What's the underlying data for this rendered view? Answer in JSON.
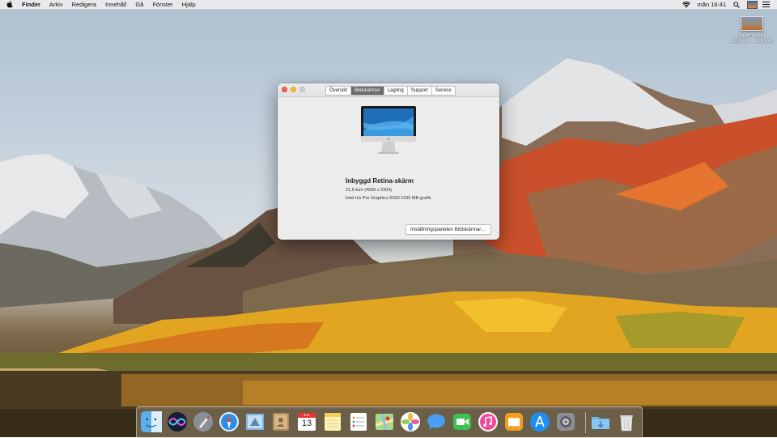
{
  "menubar": {
    "apple_icon": "apple-logo-icon",
    "items": [
      "Finder",
      "Arkiv",
      "Redigera",
      "Innehåll",
      "Gå",
      "Fönster",
      "Hjälp"
    ],
    "clock": "mån 16:41",
    "status_icons": [
      "wifi-icon",
      "search-icon",
      "menu-list-icon"
    ]
  },
  "desktop": {
    "file_label_line1": "Skärmavbild",
    "file_label_line2": "2025-08-.. 16.41.42"
  },
  "about_window": {
    "tabs": [
      "Översikt",
      "Bildskärmar",
      "Lagring",
      "Support",
      "Service"
    ],
    "active_tab": "Bildskärmar",
    "display_name": "Inbyggd Retina-skärm",
    "display_size": "21,5-tum (4096 x 2304)",
    "graphics": "Intel Iris Pro Graphics 6200 1536 MB-grafik",
    "prefs_button": "Inställningspanelen Bildskärmar…"
  },
  "dock": {
    "calendar_month": "JUL",
    "calendar_day": "13",
    "items": [
      "finder-icon",
      "siri-icon",
      "launchpad-icon",
      "safari-icon",
      "mail-icon",
      "contacts-icon",
      "calendar-icon",
      "notes-icon",
      "reminders-icon",
      "maps-icon",
      "photos-icon",
      "messages-icon",
      "facetime-icon",
      "itunes-icon",
      "ibooks-icon",
      "app-store-icon",
      "system-preferences-icon",
      "downloads-folder-icon",
      "trash-icon"
    ]
  },
  "colors": {
    "close": "#fc5f57",
    "minimize": "#fdbb2e",
    "tab_active": "#6b6b6b"
  }
}
